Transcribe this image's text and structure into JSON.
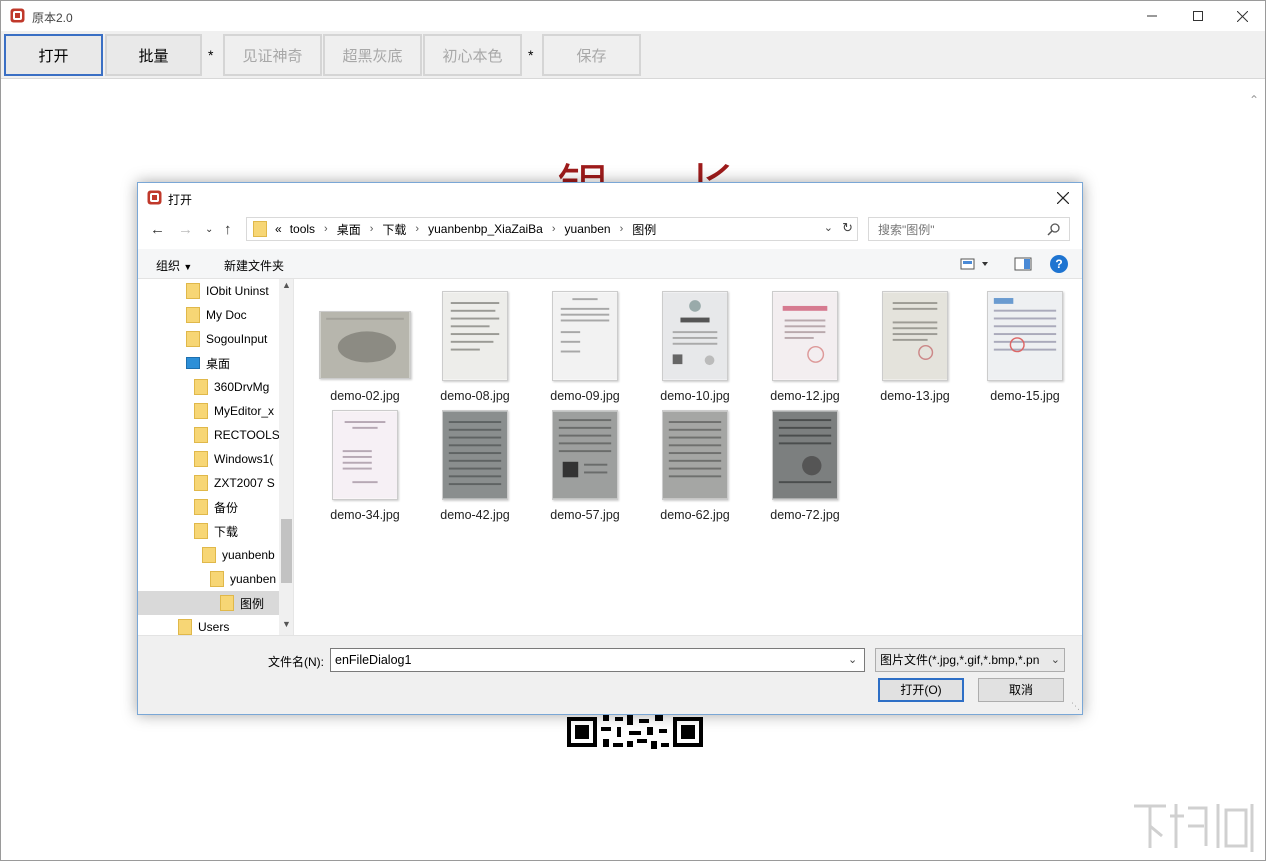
{
  "window": {
    "title": "原本2.0"
  },
  "toolbar": {
    "buttons": [
      "打开",
      "批量",
      "见证神奇",
      "超黑灰底",
      "初心本色",
      "保存"
    ],
    "separator": "*"
  },
  "background": {
    "partial_text": "银 长"
  },
  "dialog": {
    "title": "打开",
    "address": [
      "tools",
      "桌面",
      "下载",
      "yuanbenbp_XiaZaiBa",
      "yuanben",
      "图例"
    ],
    "address_prefix": "«",
    "search_placeholder": "搜索\"图例\"",
    "commands": {
      "organize": "组织",
      "new_folder": "新建文件夹"
    },
    "help": "?",
    "tree": [
      "IObit Uninst",
      "My Doc",
      "SogouInput",
      "桌面",
      "360DrvMg",
      "MyEditor_x",
      "RECTOOLS",
      "Windows1(",
      "ZXT2007 S",
      "备份",
      "下载",
      "yuanbenb",
      "yuanben",
      "图例",
      "Users"
    ],
    "files": [
      "demo-02.jpg",
      "demo-08.jpg",
      "demo-09.jpg",
      "demo-10.jpg",
      "demo-12.jpg",
      "demo-13.jpg",
      "demo-15.jpg",
      "demo-34.jpg",
      "demo-42.jpg",
      "demo-57.jpg",
      "demo-62.jpg",
      "demo-72.jpg"
    ],
    "filename_label": "文件名(N):",
    "filename_value": "enFileDialog1",
    "filter": "图片文件(*.jpg,*.gif,*.bmp,*.pn",
    "open_button": "打开(O)",
    "cancel_button": "取消"
  }
}
